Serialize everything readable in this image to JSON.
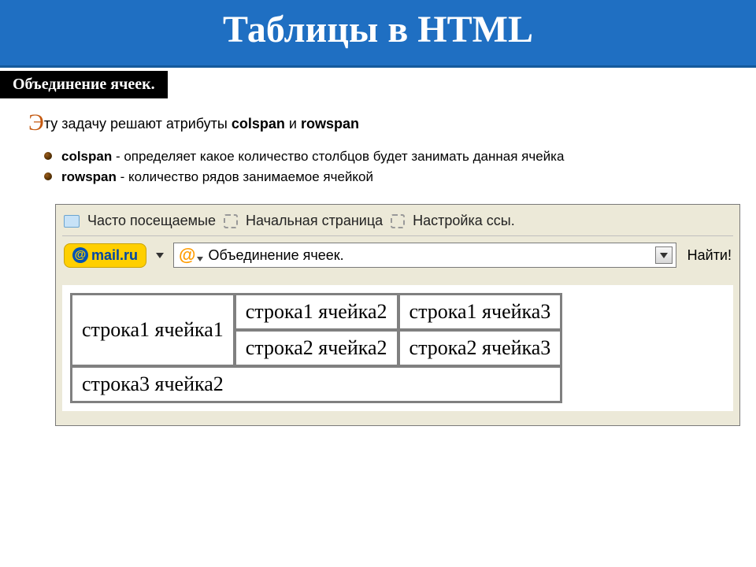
{
  "header": {
    "title": "Таблицы в HTML",
    "subtitle": "Объединение ячеек."
  },
  "intro": {
    "dropcap": "Э",
    "rest": "ту задачу решают атрибуты ",
    "kw1": "colspan",
    "and": " и ",
    "kw2": "rowspan"
  },
  "bullets": [
    {
      "name": "colspan",
      "desc": " - определяет какое количество столбцов будет занимать данная ячейка"
    },
    {
      "name": "rowspan",
      "desc": " - количество рядов занимаемое ячейкой"
    }
  ],
  "browser": {
    "bookmarks": [
      {
        "icon": "folder",
        "label": "Часто посещаемые"
      },
      {
        "icon": "dashed",
        "label": "Начальная страница"
      },
      {
        "icon": "dashed",
        "label": "Настройка ссы."
      }
    ],
    "mail_badge": "mail.ru",
    "search_text": "Объединение ячеек.",
    "find_label": "Найти!"
  },
  "table": {
    "r1c1": "строка1 ячейка1",
    "r1c2": "строка1 ячейка2",
    "r1c3": "строка1 ячейка3",
    "r2c2": "строка2 ячейка2",
    "r2c3": "строка2 ячейка3",
    "r3c2": "строка3 ячейка2"
  }
}
